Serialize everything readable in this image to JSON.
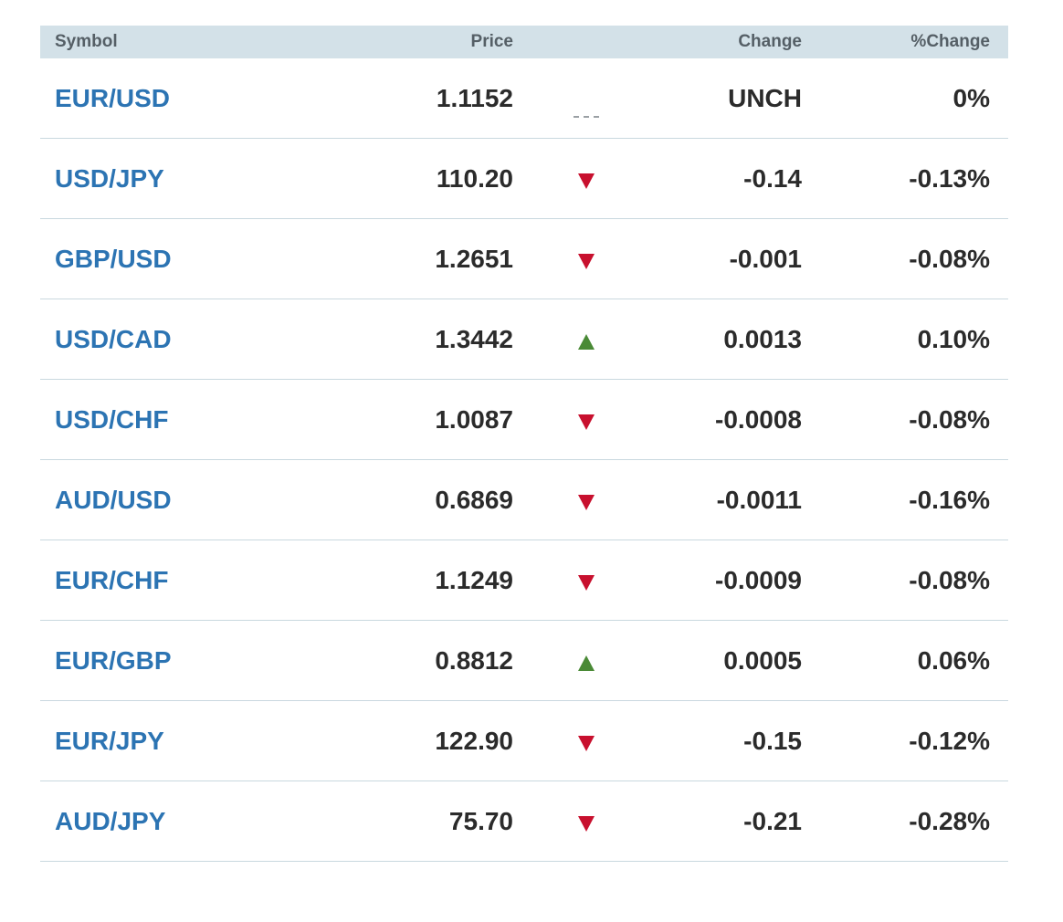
{
  "header": {
    "symbol": "Symbol",
    "price": "Price",
    "change": "Change",
    "pct_change": "%Change"
  },
  "colors": {
    "link": "#2c74b3",
    "down": "#c8102e",
    "up": "#4a8a36",
    "header_bg": "#d3e1e8"
  },
  "rows": [
    {
      "symbol": "EUR/USD",
      "price": "1.1152",
      "direction": "flat",
      "change": "UNCH",
      "pct": "0%"
    },
    {
      "symbol": "USD/JPY",
      "price": "110.20",
      "direction": "down",
      "change": "-0.14",
      "pct": "-0.13%"
    },
    {
      "symbol": "GBP/USD",
      "price": "1.2651",
      "direction": "down",
      "change": "-0.001",
      "pct": "-0.08%"
    },
    {
      "symbol": "USD/CAD",
      "price": "1.3442",
      "direction": "up",
      "change": "0.0013",
      "pct": "0.10%"
    },
    {
      "symbol": "USD/CHF",
      "price": "1.0087",
      "direction": "down",
      "change": "-0.0008",
      "pct": "-0.08%"
    },
    {
      "symbol": "AUD/USD",
      "price": "0.6869",
      "direction": "down",
      "change": "-0.0011",
      "pct": "-0.16%"
    },
    {
      "symbol": "EUR/CHF",
      "price": "1.1249",
      "direction": "down",
      "change": "-0.0009",
      "pct": "-0.08%"
    },
    {
      "symbol": "EUR/GBP",
      "price": "0.8812",
      "direction": "up",
      "change": "0.0005",
      "pct": "0.06%"
    },
    {
      "symbol": "EUR/JPY",
      "price": "122.90",
      "direction": "down",
      "change": "-0.15",
      "pct": "-0.12%"
    },
    {
      "symbol": "AUD/JPY",
      "price": "75.70",
      "direction": "down",
      "change": "-0.21",
      "pct": "-0.28%"
    }
  ]
}
